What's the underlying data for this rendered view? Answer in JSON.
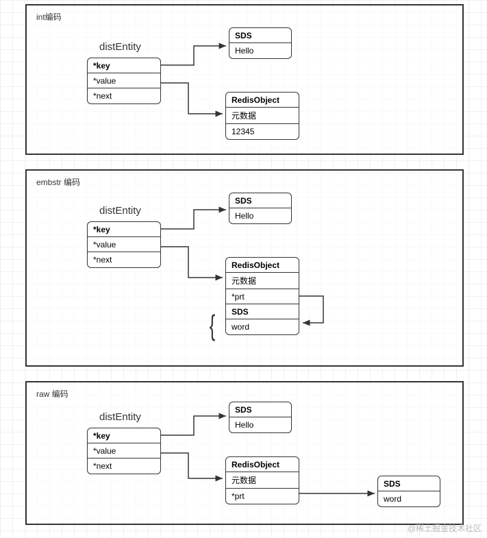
{
  "panels": {
    "int": {
      "label": "int编码"
    },
    "embstr": {
      "label": "embstr 编码"
    },
    "raw": {
      "label": "raw 编码"
    }
  },
  "entity": {
    "title": "distEntity",
    "key": "*key",
    "value": "*value",
    "next": "*next"
  },
  "sds": {
    "header": "SDS",
    "hello": "Hello",
    "word": "word"
  },
  "redisObject": {
    "header": "RedisObject",
    "meta": "元数据",
    "intval": "12345",
    "prt": "*prt"
  },
  "watermark": "@稀土掘金技术社区"
}
